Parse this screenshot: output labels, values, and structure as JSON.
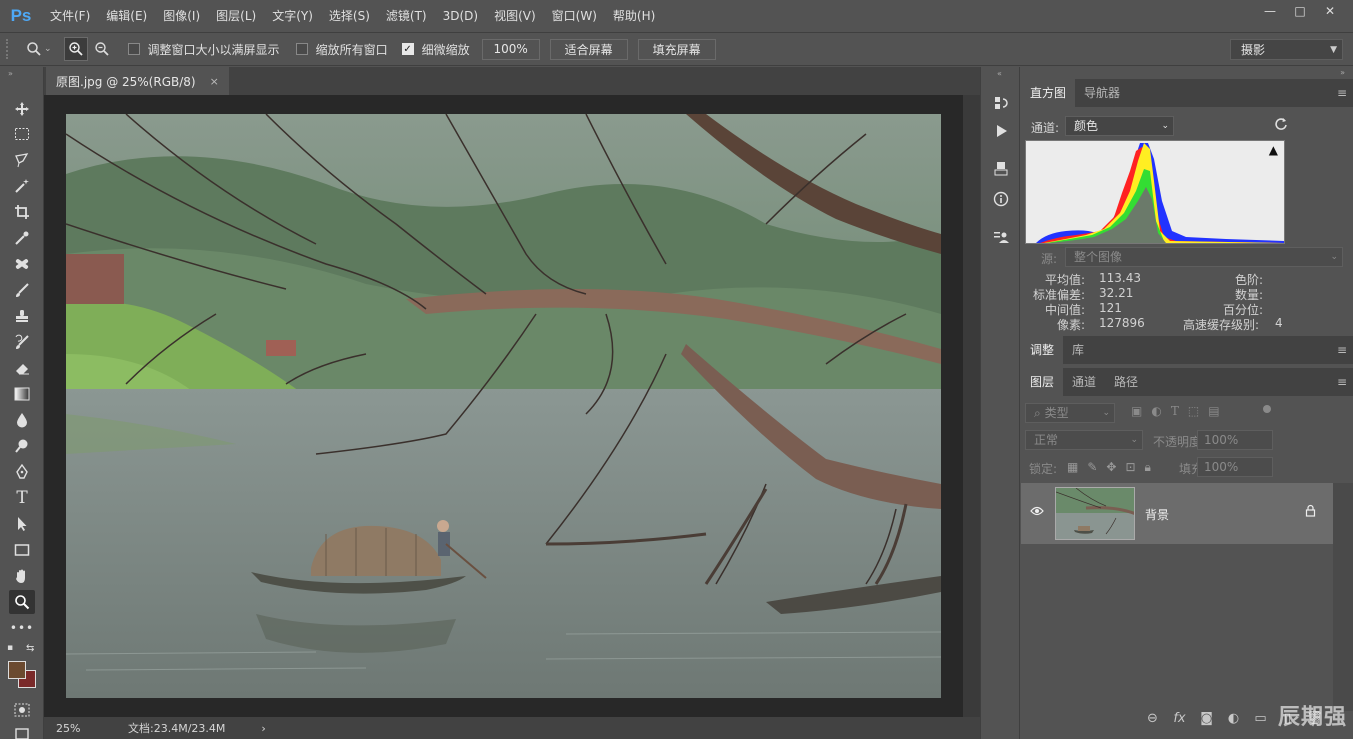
{
  "app": {
    "logo": "Ps"
  },
  "menu": [
    "文件(F)",
    "编辑(E)",
    "图像(I)",
    "图层(L)",
    "文字(Y)",
    "选择(S)",
    "滤镜(T)",
    "3D(D)",
    "视图(V)",
    "窗口(W)",
    "帮助(H)"
  ],
  "window_controls": {
    "minimize": "—",
    "restore": "□",
    "close": "✕"
  },
  "options": {
    "resize_windows_label": "调整窗口大小以满屏显示",
    "resize_windows_checked": false,
    "zoom_all_label": "缩放所有窗口",
    "zoom_all_checked": false,
    "scrubby_zoom_label": "细微缩放",
    "scrubby_zoom_checked": true,
    "zoom_100_label": "100%",
    "fit_screen_label": "适合屏幕",
    "fill_screen_label": "填充屏幕",
    "workspace": "摄影"
  },
  "document": {
    "tab_title": "原图.jpg @ 25%(RGB/8)",
    "close_glyph": "×",
    "zoom": "25%",
    "doc_info": "文档:23.4M/23.4M",
    "status_arrow": "›"
  },
  "histogram_panel": {
    "tabs": [
      "直方图",
      "导航器"
    ],
    "active_tab": 0,
    "channel_label": "通道:",
    "channel_value": "颜色",
    "source_label": "源:",
    "source_value": "整个图像",
    "warning_glyph": "▲",
    "stats": {
      "mean_label": "平均值:",
      "mean": "113.43",
      "std_label": "标准偏差:",
      "std": "32.21",
      "median_label": "中间值:",
      "median": "121",
      "pixels_label": "像素:",
      "pixels": "127896",
      "level_label": "色阶:",
      "count_label": "数量:",
      "percentile_label": "百分位:",
      "cache_label": "高速缓存级别:",
      "cache": "4"
    }
  },
  "adjust_panel": {
    "tabs": [
      "调整",
      "库"
    ]
  },
  "layers_panel": {
    "tabs": [
      "图层",
      "通道",
      "路径"
    ],
    "filter_kind": "类型",
    "blend_mode": "正常",
    "opacity_label": "不透明度:",
    "opacity": "100%",
    "lock_label": "锁定:",
    "fill_label": "填充:",
    "fill": "100%",
    "layers": [
      {
        "name": "背景",
        "locked": true,
        "visible": true
      }
    ]
  },
  "watermark": "辰期强",
  "colors": {
    "foreground": "#6b4a30",
    "background": "#7a2a2a",
    "accent_blue": "#4ea8f5"
  }
}
